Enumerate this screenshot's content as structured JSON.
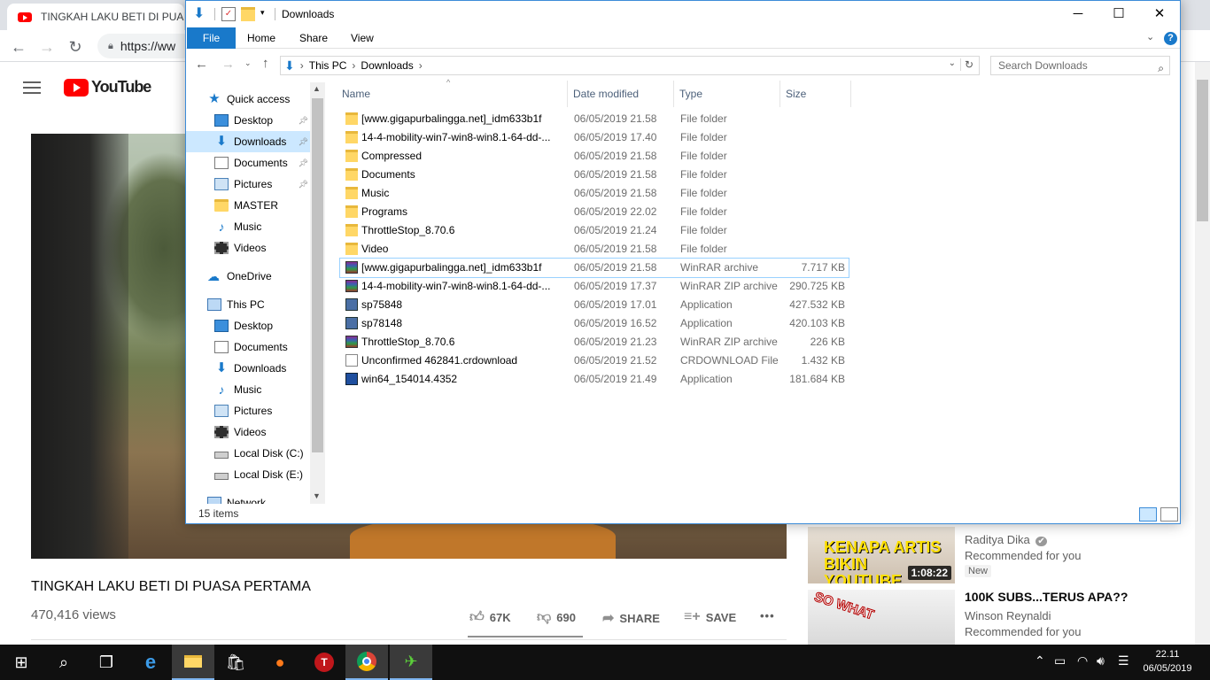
{
  "chrome": {
    "tab_title": "TINGKAH LAKU BETI DI PUASA",
    "url": "https://ww"
  },
  "youtube": {
    "logo_text": "YouTube",
    "video_title": "TINGKAH LAKU BETI DI PUASA PERTAMA",
    "views": "470,416 views",
    "likes": "67K",
    "dislikes": "690",
    "share_label": "SHARE",
    "save_label": "SAVE",
    "more_label": "•••",
    "recommendations": [
      {
        "thumb_text": "KENAPA ARTIS BIKIN YOUTUBE",
        "duration": "1:08:22",
        "title": "",
        "channel": "Raditya Dika",
        "verified": "✔",
        "sub": "Recommended for you",
        "badge": "New"
      },
      {
        "thumb_text": "SO WHAT",
        "duration": "",
        "title": "100K SUBS...TERUS APA??",
        "channel": "Winson Reynaldi",
        "verified": "",
        "sub": "Recommended for you",
        "badge": ""
      }
    ]
  },
  "explorer": {
    "title": "Downloads",
    "ribbon_tabs": [
      "File",
      "Home",
      "Share",
      "View"
    ],
    "help": "?",
    "breadcrumb": [
      "This PC",
      "Downloads"
    ],
    "search_placeholder": "Search Downloads",
    "nav": {
      "quick_access": "Quick access",
      "qa_items": [
        "Desktop",
        "Downloads",
        "Documents",
        "Pictures",
        "MASTER",
        "Music",
        "Videos"
      ],
      "onedrive": "OneDrive",
      "this_pc": "This PC",
      "pc_items": [
        "Desktop",
        "Documents",
        "Downloads",
        "Music",
        "Pictures",
        "Videos",
        "Local Disk (C:)",
        "Local Disk (E:)"
      ],
      "network": "Network"
    },
    "columns": [
      "Name",
      "Date modified",
      "Type",
      "Size"
    ],
    "files": [
      {
        "name": "[www.gigapurbalingga.net]_idm633b1f",
        "date": "06/05/2019 21.58",
        "type": "File folder",
        "size": "",
        "icon": "folder"
      },
      {
        "name": "14-4-mobility-win7-win8-win8.1-64-dd-...",
        "date": "06/05/2019 17.40",
        "type": "File folder",
        "size": "",
        "icon": "folder"
      },
      {
        "name": "Compressed",
        "date": "06/05/2019 21.58",
        "type": "File folder",
        "size": "",
        "icon": "folder"
      },
      {
        "name": "Documents",
        "date": "06/05/2019 21.58",
        "type": "File folder",
        "size": "",
        "icon": "folder"
      },
      {
        "name": "Music",
        "date": "06/05/2019 21.58",
        "type": "File folder",
        "size": "",
        "icon": "folder"
      },
      {
        "name": "Programs",
        "date": "06/05/2019 22.02",
        "type": "File folder",
        "size": "",
        "icon": "folder"
      },
      {
        "name": "ThrottleStop_8.70.6",
        "date": "06/05/2019 21.24",
        "type": "File folder",
        "size": "",
        "icon": "folder"
      },
      {
        "name": "Video",
        "date": "06/05/2019 21.58",
        "type": "File folder",
        "size": "",
        "icon": "folder"
      },
      {
        "name": "[www.gigapurbalingga.net]_idm633b1f",
        "date": "06/05/2019 21.58",
        "type": "WinRAR archive",
        "size": "7.717 KB",
        "icon": "rar"
      },
      {
        "name": "14-4-mobility-win7-win8-win8.1-64-dd-...",
        "date": "06/05/2019 17.37",
        "type": "WinRAR ZIP archive",
        "size": "290.725 KB",
        "icon": "rar"
      },
      {
        "name": "sp75848",
        "date": "06/05/2019 17.01",
        "type": "Application",
        "size": "427.532 KB",
        "icon": "app"
      },
      {
        "name": "sp78148",
        "date": "06/05/2019 16.52",
        "type": "Application",
        "size": "420.103 KB",
        "icon": "app"
      },
      {
        "name": "ThrottleStop_8.70.6",
        "date": "06/05/2019 21.23",
        "type": "WinRAR ZIP archive",
        "size": "226 KB",
        "icon": "rar"
      },
      {
        "name": "Unconfirmed 462841.crdownload",
        "date": "06/05/2019 21.52",
        "type": "CRDOWNLOAD File",
        "size": "1.432 KB",
        "icon": "doc"
      },
      {
        "name": "win64_154014.4352",
        "date": "06/05/2019 21.49",
        "type": "Application",
        "size": "181.684 KB",
        "icon": "win"
      }
    ],
    "selected_index": 8,
    "status": "15 items"
  },
  "taskbar": {
    "time": "22.11",
    "date": "06/05/2019"
  }
}
